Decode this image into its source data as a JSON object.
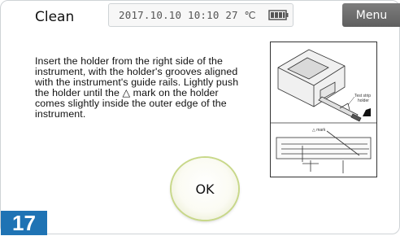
{
  "header": {
    "title": "Clean",
    "status_text": "2017.10.10 10:10 27 ℃",
    "battery_icon": "battery-icon",
    "menu_label": "Menu"
  },
  "main": {
    "instructions": "Insert the holder from the right side of the instrument, with the holder's grooves aligned with the instrument's guide rails. Lightly push the holder until the △ mark on the holder comes slightly inside the outer edge of the instrument.",
    "illustration": {
      "label_test_strip": "Test strip",
      "label_holder": "holder",
      "label_mark": "△ mark"
    },
    "ok_label": "OK"
  },
  "step": {
    "number": "17"
  },
  "colors": {
    "menu_bg": "#6e6e6e",
    "step_badge": "#1f73b4",
    "ok_ring": "#c8d889"
  }
}
